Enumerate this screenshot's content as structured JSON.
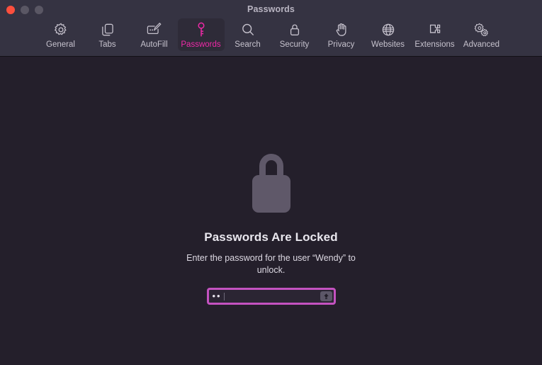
{
  "window": {
    "title": "Passwords",
    "traffic_lights": [
      {
        "name": "close",
        "color": "#fc4f3d"
      },
      {
        "name": "minimize",
        "color": "#5a5764"
      },
      {
        "name": "zoom",
        "color": "#5a5764"
      }
    ]
  },
  "toolbar": {
    "selected": "Passwords",
    "accent_color": "#ef29a8",
    "items": [
      {
        "label": "General",
        "icon": "gear-icon"
      },
      {
        "label": "Tabs",
        "icon": "tabs-icon"
      },
      {
        "label": "AutoFill",
        "icon": "autofill-icon"
      },
      {
        "label": "Passwords",
        "icon": "key-icon"
      },
      {
        "label": "Search",
        "icon": "search-icon"
      },
      {
        "label": "Security",
        "icon": "lock-icon"
      },
      {
        "label": "Privacy",
        "icon": "hand-icon"
      },
      {
        "label": "Websites",
        "icon": "globe-icon"
      },
      {
        "label": "Extensions",
        "icon": "puzzle-icon"
      },
      {
        "label": "Advanced",
        "icon": "gears-icon"
      }
    ]
  },
  "main": {
    "lock_icon": "padlock-icon",
    "lock_icon_color": "#5f5869",
    "title": "Passwords Are Locked",
    "subtitle": "Enter the password for the user “Wendy” to unlock.",
    "password_field": {
      "value": "••",
      "placeholder": "",
      "focus_ring_color": "#c452c0",
      "capslock_icon": "caps-lock-arrow-icon"
    }
  }
}
